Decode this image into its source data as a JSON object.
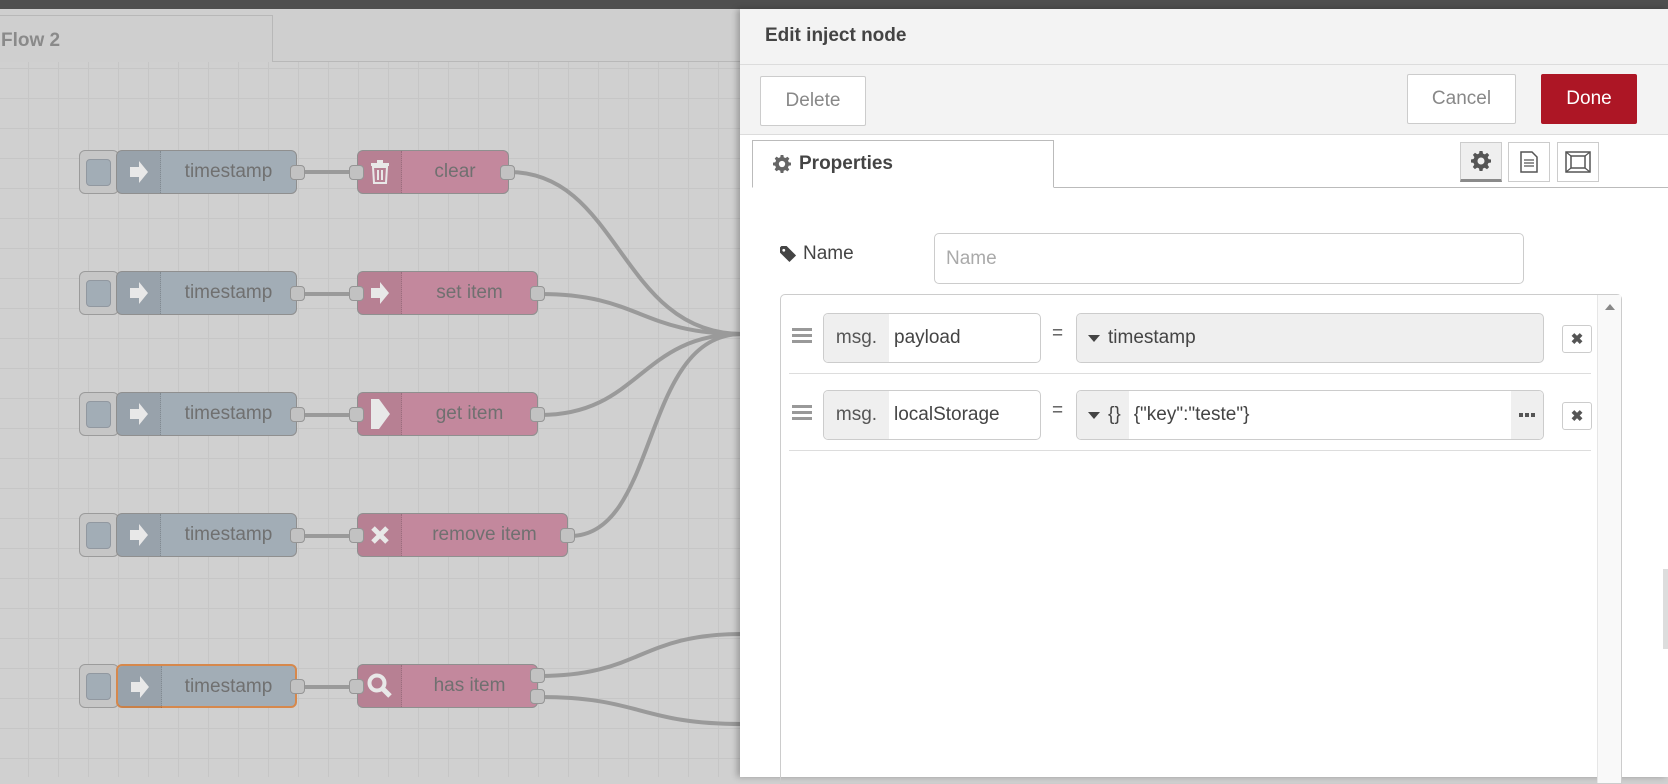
{
  "workspace": {
    "flow_tab": "Flow 2",
    "flows": [
      {
        "inject_label": "timestamp",
        "target_label": "clear",
        "target_icon": "trash-icon"
      },
      {
        "inject_label": "timestamp",
        "target_label": "set item",
        "target_icon": "arrow-right-icon"
      },
      {
        "inject_label": "timestamp",
        "target_label": "get item",
        "target_icon": "arrow-right-bold-icon"
      },
      {
        "inject_label": "timestamp",
        "target_label": "remove item",
        "target_icon": "x-icon"
      },
      {
        "inject_label": "timestamp",
        "target_label": "has item",
        "target_icon": "search-icon",
        "selected": true
      }
    ]
  },
  "tray": {
    "title": "Edit inject node",
    "delete_label": "Delete",
    "cancel_label": "Cancel",
    "done_label": "Done",
    "done_color": "#ad1625",
    "properties_tab": "Properties",
    "name_label": "Name",
    "name_placeholder": "Name",
    "name_value": "",
    "props": [
      {
        "prefix": "msg.",
        "property": "payload",
        "equals": "=",
        "type_icon": "",
        "value": "timestamp",
        "expandable": false
      },
      {
        "prefix": "msg.",
        "property": "localStorage",
        "equals": "=",
        "type_icon": "{}",
        "value": "{\"key\":\"teste\"}",
        "expandable": true
      }
    ]
  }
}
